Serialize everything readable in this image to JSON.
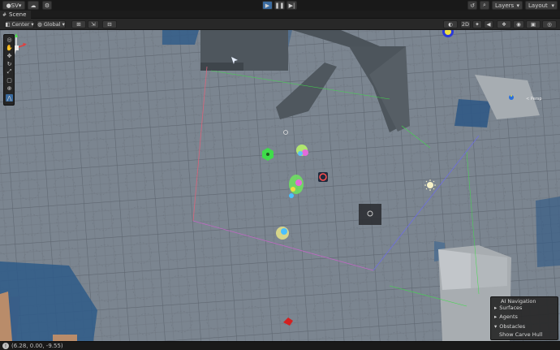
{
  "top_bar": {
    "account_label": "SV",
    "layers_label": "Layers",
    "layout_label": "Layout",
    "icons": [
      "account-icon",
      "cloud-icon",
      "settings-icon",
      "play-icon",
      "pause-icon",
      "step-icon",
      "history-icon",
      "search-icon"
    ]
  },
  "tabs": {
    "scene_label": "Scene"
  },
  "scene_toolbar": {
    "pivot_label": "Center",
    "space_label": "Global",
    "mode_2d_label": "2D"
  },
  "gizmo": {
    "persp_label": "< Persp"
  },
  "ai_navigation": {
    "title": "AI Navigation",
    "items": [
      {
        "label": "Surfaces",
        "expanded": false
      },
      {
        "label": "Agents",
        "expanded": false
      },
      {
        "label": "Obstacles",
        "expanded": true
      }
    ],
    "show_carve_hull_label": "Show Carve Hull"
  },
  "status_bar": {
    "coordinates": "(6.28, 0.00, -9.55)"
  },
  "colors": {
    "accent": "#3a6a9e",
    "ground": "#7b8590",
    "building": "#4e565d",
    "water": "#2e5a88",
    "nav_green": "#3fdc4a"
  }
}
